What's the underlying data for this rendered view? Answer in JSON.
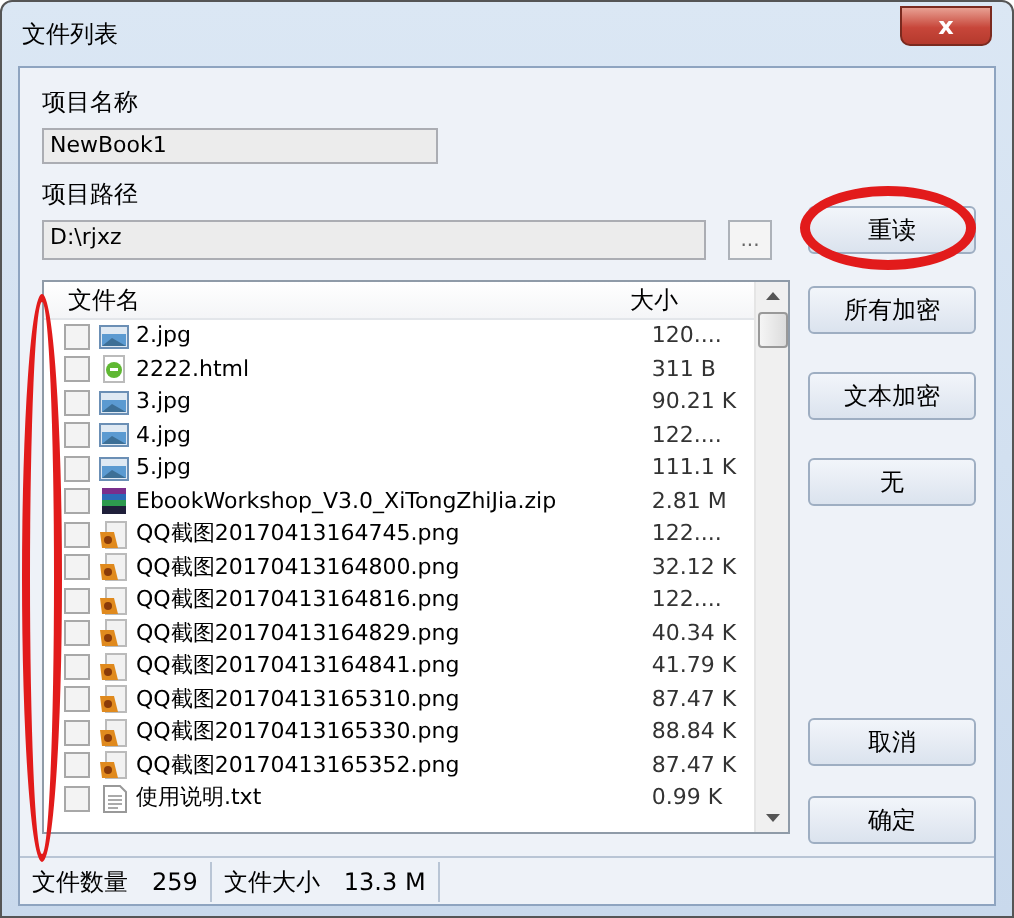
{
  "window": {
    "title": "文件列表",
    "close": "x"
  },
  "project_name": {
    "label": "项目名称",
    "value": "NewBook1"
  },
  "project_path": {
    "label": "项目路径",
    "value": "D:\\rjxz",
    "browse": "..."
  },
  "reload_button": {
    "label": "重读",
    "circled": true
  },
  "file_list": {
    "columns": [
      "文件名",
      "大小"
    ],
    "checkbox_column_circled": true,
    "rows": [
      {
        "name": "2.jpg",
        "size": "120....",
        "kind": "image",
        "checked": false
      },
      {
        "name": "2222.html",
        "size": "311 B",
        "kind": "html",
        "checked": false
      },
      {
        "name": "3.jpg",
        "size": "90.21 K",
        "kind": "image",
        "checked": false
      },
      {
        "name": "4.jpg",
        "size": "122....",
        "kind": "image",
        "checked": false
      },
      {
        "name": "5.jpg",
        "size": "111.1 K",
        "kind": "image",
        "checked": false
      },
      {
        "name": "EbookWorkshop_V3.0_XiTongZhiJia.zip",
        "size": "2.81 M",
        "kind": "zip",
        "checked": false
      },
      {
        "name": "QQ截图20170413164745.png",
        "size": "122....",
        "kind": "png",
        "checked": false
      },
      {
        "name": "QQ截图20170413164800.png",
        "size": "32.12 K",
        "kind": "png",
        "checked": false
      },
      {
        "name": "QQ截图20170413164816.png",
        "size": "122....",
        "kind": "png",
        "checked": false
      },
      {
        "name": "QQ截图20170413164829.png",
        "size": "40.34 K",
        "kind": "png",
        "checked": false
      },
      {
        "name": "QQ截图20170413164841.png",
        "size": "41.79 K",
        "kind": "png",
        "checked": false
      },
      {
        "name": "QQ截图20170413165310.png",
        "size": "87.47 K",
        "kind": "png",
        "checked": false
      },
      {
        "name": "QQ截图20170413165330.png",
        "size": "88.84 K",
        "kind": "png",
        "checked": false
      },
      {
        "name": "QQ截图20170413165352.png",
        "size": "87.47 K",
        "kind": "png",
        "checked": false
      },
      {
        "name": "使用说明.txt",
        "size": "0.99 K",
        "kind": "txt",
        "checked": false
      }
    ]
  },
  "side_buttons": [
    "所有加密",
    "文本加密",
    "无"
  ],
  "bottom_buttons": [
    "取消",
    "确定"
  ],
  "status_bar": [
    {
      "label": "文件数量",
      "value": "259"
    },
    {
      "label": "文件大小",
      "value": "13.3 M"
    }
  ]
}
